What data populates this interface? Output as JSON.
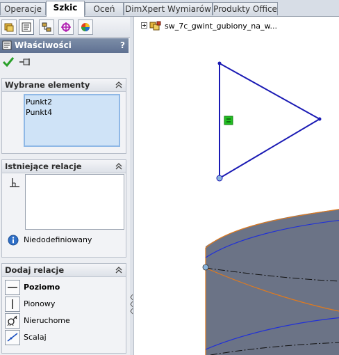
{
  "tabs": [
    {
      "label": "Operacje",
      "active": false
    },
    {
      "label": "Szkic",
      "active": true
    },
    {
      "label": "Oceń",
      "active": false
    },
    {
      "label": "DimXpert Wymiarów",
      "active": false
    },
    {
      "label": "Produkty Office",
      "active": false
    }
  ],
  "manager_tabs": [
    "feature-manager-icon",
    "property-manager-icon",
    "configuration-manager-icon",
    "dimxpert-manager-icon",
    "display-manager-icon"
  ],
  "property_manager": {
    "title": "Właściwości",
    "help_label": "?"
  },
  "selected_elements": {
    "title": "Wybrane elementy",
    "items": [
      "Punkt2",
      "Punkt4"
    ]
  },
  "existing_relations": {
    "title": "Istniejące relacje",
    "items": [],
    "status": "Niedodefiniowany"
  },
  "add_relations": {
    "title": "Dodaj relacje",
    "items": [
      {
        "label": "Poziomo",
        "icon": "horizontal-relation-icon"
      },
      {
        "label": "Pionowy",
        "icon": "vertical-relation-icon"
      },
      {
        "label": "Nieruchome",
        "icon": "fix-relation-icon"
      },
      {
        "label": "Scalaj",
        "icon": "merge-relation-icon"
      }
    ]
  },
  "feature_tree": {
    "part_name": "sw_7c_gwint_gubiony_na_w..."
  },
  "colors": {
    "sketch_line": "#1a1ab4",
    "model_edge": "#e07a1e",
    "model_face": "#6b7386",
    "relation_marker": "#22c022",
    "header": "#6a7b99"
  }
}
